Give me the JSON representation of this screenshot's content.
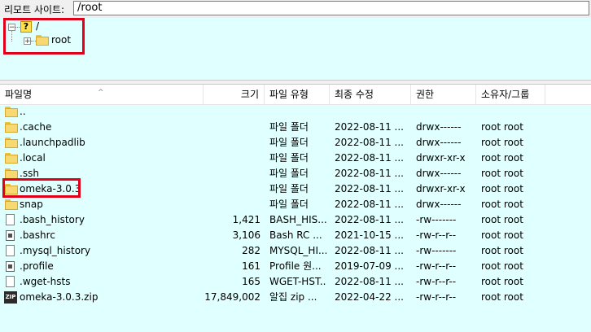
{
  "address_bar": {
    "label": "리모트 사이트:",
    "path": "/root"
  },
  "tree": {
    "root_label": "/",
    "child_label": "root",
    "root_expander": "−",
    "child_expander": "+"
  },
  "columns": {
    "name": "파일명",
    "size": "크기",
    "type": "파일 유형",
    "modified": "최종 수정",
    "permissions": "권한",
    "owner": "소유자/그룹"
  },
  "files": [
    {
      "icon": "folder-icon",
      "name": "..",
      "size": "",
      "type": "",
      "modified": "",
      "permissions": "",
      "owner": ""
    },
    {
      "icon": "folder-icon",
      "name": ".cache",
      "size": "",
      "type": "파일 폴더",
      "modified": "2022-08-11 ...",
      "permissions": "drwx------",
      "owner": "root root"
    },
    {
      "icon": "folder-icon",
      "name": ".launchpadlib",
      "size": "",
      "type": "파일 폴더",
      "modified": "2022-08-11 ...",
      "permissions": "drwx------",
      "owner": "root root"
    },
    {
      "icon": "folder-icon",
      "name": ".local",
      "size": "",
      "type": "파일 폴더",
      "modified": "2022-08-11 ...",
      "permissions": "drwxr-xr-x",
      "owner": "root root"
    },
    {
      "icon": "folder-icon",
      "name": ".ssh",
      "size": "",
      "type": "파일 폴더",
      "modified": "2022-08-11 ...",
      "permissions": "drwx------",
      "owner": "root root"
    },
    {
      "icon": "folder-icon",
      "name": "omeka-3.0.3",
      "size": "",
      "type": "파일 폴더",
      "modified": "2022-08-11 ...",
      "permissions": "drwxr-xr-x",
      "owner": "root root"
    },
    {
      "icon": "folder-icon",
      "name": "snap",
      "size": "",
      "type": "파일 폴더",
      "modified": "2022-08-11 ...",
      "permissions": "drwx------",
      "owner": "root root"
    },
    {
      "icon": "file-icon",
      "name": ".bash_history",
      "size": "1,421",
      "type": "BASH_HIS...",
      "modified": "2022-08-11 ...",
      "permissions": "-rw-------",
      "owner": "root root"
    },
    {
      "icon": "config-file-icon",
      "name": ".bashrc",
      "size": "3,106",
      "type": "Bash RC ...",
      "modified": "2021-10-15 ...",
      "permissions": "-rw-r--r--",
      "owner": "root root"
    },
    {
      "icon": "file-icon",
      "name": ".mysql_history",
      "size": "282",
      "type": "MYSQL_HI...",
      "modified": "2022-08-11 ...",
      "permissions": "-rw-------",
      "owner": "root root"
    },
    {
      "icon": "config-file-icon",
      "name": ".profile",
      "size": "161",
      "type": "Profile 원...",
      "modified": "2019-07-09 ...",
      "permissions": "-rw-r--r--",
      "owner": "root root"
    },
    {
      "icon": "file-icon",
      "name": ".wget-hsts",
      "size": "165",
      "type": "WGET-HST...",
      "modified": "2022-08-11 ...",
      "permissions": "-rw-r--r--",
      "owner": "root root"
    },
    {
      "icon": "zip-archive-icon",
      "name": "omeka-3.0.3.zip",
      "size": "17,849,002",
      "type": "알집 zip ...",
      "modified": "2022-04-22 ...",
      "permissions": "-rw-r--r--",
      "owner": "root root",
      "icon_text": "ZIP"
    }
  ],
  "colors": {
    "pane_background": "#e0ffff",
    "highlight_border": "#e0001a"
  }
}
